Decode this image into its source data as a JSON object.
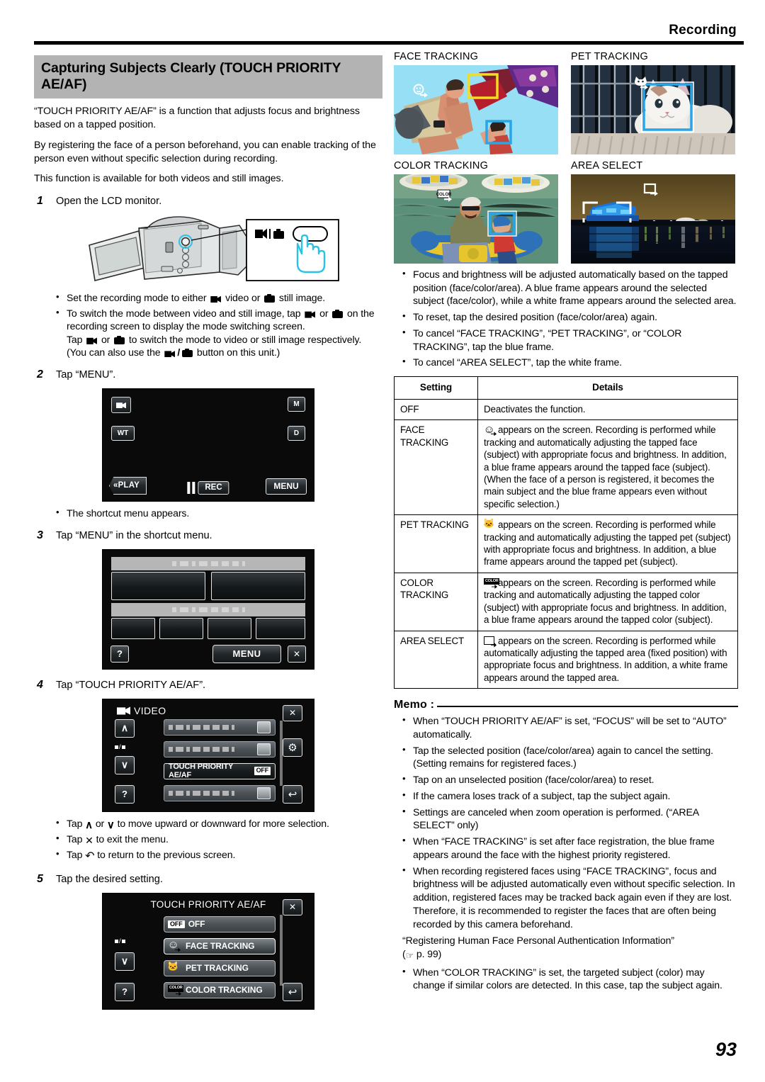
{
  "header": {
    "section_label": "Recording"
  },
  "title": "Capturing Subjects Clearly (TOUCH PRIORITY AE/AF)",
  "intro": {
    "p1": "“TOUCH PRIORITY AE/AF” is a function that adjusts focus and brightness based on a tapped position.",
    "p2": "By registering the face of a person beforehand, you can enable tracking of the person even without specific selection during recording.",
    "p3": "This function is available for both videos and still images."
  },
  "steps": {
    "s1": {
      "num": "1",
      "text": "Open the LCD monitor."
    },
    "s2": {
      "num": "2",
      "text": "Tap “MENU”."
    },
    "s3": {
      "num": "3",
      "text": "Tap “MENU” in the shortcut menu."
    },
    "s4": {
      "num": "4",
      "text": "Tap “TOUCH PRIORITY AE/AF”."
    },
    "s5": {
      "num": "5",
      "text": "Tap the desired setting."
    }
  },
  "step1_bullets": {
    "b1_a": "Set the recording mode to either",
    "b1_video": "video or",
    "b1_still": "still image.",
    "b2_a": "To switch the mode between video and still image, tap",
    "b2_or": "or",
    "b2_b": "on the recording screen to display the mode switching screen.",
    "b2_c": "Tap",
    "b2_d": "or",
    "b2_e": "to switch the mode to video or still image respectively.",
    "b2_f": "(You can also use the",
    "b2_g": "button on this unit.)"
  },
  "step2_bullets": {
    "b1": "The shortcut menu appears."
  },
  "step4_bullets": {
    "b1_a": "Tap",
    "b1_b": "or",
    "b1_c": "to move upward or downward for more selection.",
    "b2_a": "Tap",
    "b2_b": "to exit the menu.",
    "b3_a": "Tap",
    "b3_b": "to return to the previous screen."
  },
  "rec_screen": {
    "mode_icon": "video-icon",
    "manual_label": "M",
    "zoom_label": "WT",
    "display_label": "D",
    "play_label": "«PLAY",
    "rec_label": "REC",
    "menu_label": "MENU"
  },
  "shortcut_screen": {
    "help_label": "?",
    "menu_label": "MENU",
    "close_label": "✕"
  },
  "video_menu_screen": {
    "title": "VIDEO",
    "close_label": "✕",
    "up_label": "∧",
    "down_label": "∨",
    "help_label": "?",
    "page_label": "/",
    "gear_label": "⚙",
    "return_label": "↩",
    "selected_row_label": "TOUCH PRIORITY AE/AF",
    "selected_row_value": "OFF"
  },
  "settings_screen": {
    "title": "TOUCH PRIORITY AE/AF",
    "close_label": "✕",
    "down_label": "∨",
    "help_label": "?",
    "page_label": "/",
    "return_label": "↩",
    "options": [
      {
        "badge": "OFF",
        "label": "OFF",
        "icon": "off-icon",
        "highlighted": false
      },
      {
        "badge": "",
        "label": "FACE TRACKING",
        "icon": "face-tracking-icon",
        "highlighted": true
      },
      {
        "badge": "",
        "label": "PET TRACKING",
        "icon": "pet-tracking-icon",
        "highlighted": false
      },
      {
        "badge": "COLOR",
        "label": "COLOR TRACKING",
        "icon": "color-tracking-icon",
        "highlighted": false
      }
    ]
  },
  "photos": [
    {
      "caption": "FACE TRACKING",
      "name": "face-tracking-photo"
    },
    {
      "caption": "PET TRACKING",
      "name": "pet-tracking-photo"
    },
    {
      "caption": "COLOR TRACKING",
      "name": "color-tracking-photo"
    },
    {
      "caption": "AREA SELECT",
      "name": "area-select-photo"
    }
  ],
  "right_bullets": {
    "b1": "Focus and brightness will be adjusted automatically based on the tapped position (face/color/area). A blue frame appears around the selected subject (face/color), while a white frame appears around the selected area.",
    "b2": "To reset, tap the desired position (face/color/area) again.",
    "b3": "To cancel “FACE TRACKING”, “PET TRACKING”, or “COLOR TRACKING”, tap the blue frame.",
    "b4": "To cancel “AREA SELECT”, tap the white frame."
  },
  "settings_table": {
    "headers": {
      "setting": "Setting",
      "details": "Details"
    },
    "rows": [
      {
        "setting": "OFF",
        "icon": "",
        "details": "Deactivates the function."
      },
      {
        "setting": "FACE TRACKING",
        "icon": "face-tracking-icon",
        "details": "appears on the screen. Recording is performed while tracking and automatically adjusting the tapped face (subject) with appropriate focus and brightness. In addition, a blue frame appears around the tapped face (subject). (When the face of a person is registered, it becomes the main subject and the blue frame appears even without specific selection.)"
      },
      {
        "setting": "PET TRACKING",
        "icon": "pet-tracking-icon",
        "details": "appears on the screen. Recording is performed while tracking and automatically adjusting the tapped pet (subject) with appropriate focus and brightness. In addition, a blue frame appears around the tapped pet (subject)."
      },
      {
        "setting": "COLOR TRACKING",
        "icon": "color-tracking-icon",
        "details": "appears on the screen. Recording is performed while tracking and automatically adjusting the tapped color (subject) with appropriate focus and brightness. In addition, a blue frame appears around the tapped color (subject)."
      },
      {
        "setting": "AREA SELECT",
        "icon": "area-select-icon",
        "details": "appears on the screen. Recording is performed while automatically adjusting the tapped area (fixed position) with appropriate focus and brightness. In addition, a white frame appears around the tapped area."
      }
    ]
  },
  "memo": {
    "heading": "Memo :",
    "bullets": [
      "When “TOUCH PRIORITY AE/AF” is set, “FOCUS” will be set to “AUTO” automatically.",
      "Tap the selected position (face/color/area) again to cancel the setting. (Setting remains for registered faces.)",
      "Tap on an unselected position (face/color/area) to reset.",
      "If the camera loses track of a subject, tap the subject again.",
      "Settings are canceled when zoom operation is performed. (“AREA SELECT” only)",
      "When “FACE TRACKING” is set after face registration, the blue frame appears around the face with the highest priority registered.",
      "When recording registered faces using “FACE TRACKING”, focus and brightness will be adjusted automatically even without specific selection. In addition, registered faces may be tracked back again even if they are lost. Therefore, it is recommended to register the faces that are often being recorded by this camera beforehand."
    ],
    "reference_title": "“Registering Human Face Personal Authentication Information”",
    "reference_page": "p. 99",
    "last_bullet": "When “COLOR TRACKING” is set, the targeted subject (color) may change if similar colors are detected. In this case, tap the subject again."
  },
  "page_number": "93"
}
